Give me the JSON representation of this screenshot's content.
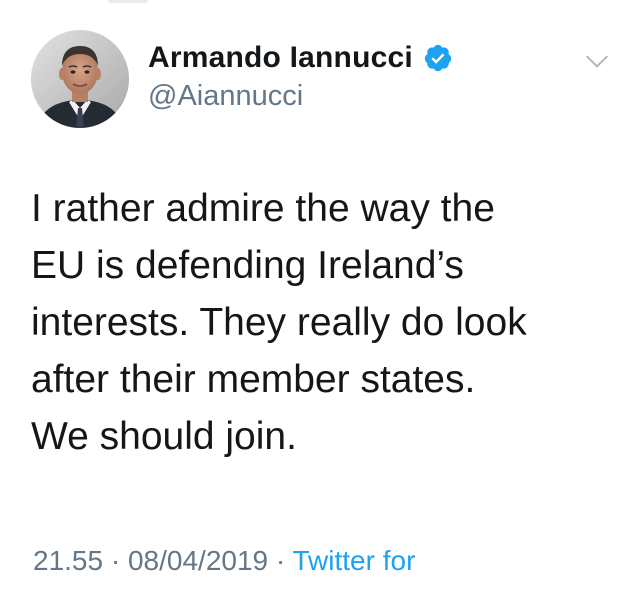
{
  "tweet": {
    "display_name": "Armando Iannucci",
    "handle": "@Aiannucci",
    "verified_icon": "verified-badge-icon",
    "menu_icon": "chevron-down-icon",
    "text_lines": [
      "I rather admire the way the",
      "EU is defending Ireland’s",
      "interests. They really do look",
      "after their member states.",
      "We should join."
    ],
    "time": "21.55",
    "separator1": " · ",
    "date": "08/04/2019",
    "separator2": " · ",
    "source": "Twitter for"
  },
  "colors": {
    "text": "#14171a",
    "secondary": "#657786",
    "accent": "#1da1f2"
  }
}
